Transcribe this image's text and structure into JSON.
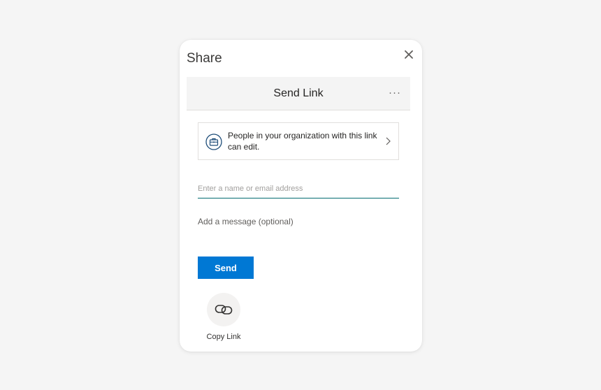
{
  "dialog": {
    "title": "Share",
    "close_icon": "close-icon"
  },
  "header": {
    "title": "Send Link",
    "more_label": "···"
  },
  "permission": {
    "icon": "briefcase-icon",
    "text": "People in your organization with this link can edit.",
    "chevron_icon": "chevron-right-icon"
  },
  "recipient": {
    "placeholder": "Enter a name or email address",
    "value": ""
  },
  "message": {
    "placeholder": "Add a message (optional)",
    "value": ""
  },
  "send": {
    "label": "Send"
  },
  "copy_link": {
    "icon": "link-icon",
    "label": "Copy Link"
  },
  "colors": {
    "accent": "#0078d4",
    "input_underline": "#036c70",
    "icon_blue": "#1f4e79"
  }
}
